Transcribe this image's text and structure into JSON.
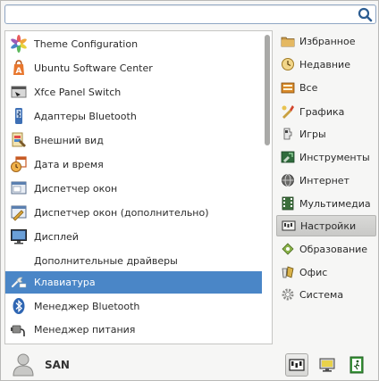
{
  "search": {
    "value": "",
    "placeholder": ""
  },
  "apps": [
    {
      "label": "Theme Configuration",
      "icon": "theme-configuration-icon"
    },
    {
      "label": "Ubuntu Software Center",
      "icon": "software-center-icon"
    },
    {
      "label": "Xfce Panel Switch",
      "icon": "panel-switch-icon"
    },
    {
      "label": "Адаптеры Bluetooth",
      "icon": "bluetooth-adapter-icon"
    },
    {
      "label": "Внешний вид",
      "icon": "appearance-icon"
    },
    {
      "label": "Дата и время",
      "icon": "date-time-icon"
    },
    {
      "label": "Диспетчер окон",
      "icon": "window-manager-icon"
    },
    {
      "label": "Диспетчер окон (дополнительно)",
      "icon": "window-manager-tweaks-icon"
    },
    {
      "label": "Дисплей",
      "icon": "display-icon"
    },
    {
      "label": "Дополнительные драйверы",
      "icon": ""
    },
    {
      "label": "Клавиатура",
      "icon": "keyboard-icon"
    },
    {
      "label": "Менеджер Bluetooth",
      "icon": "bluetooth-icon"
    },
    {
      "label": "Менеджер питания",
      "icon": "power-manager-icon"
    }
  ],
  "selected_app": "Клавиатура",
  "categories": [
    {
      "label": "Избранное",
      "icon": "favorites-icon"
    },
    {
      "label": "Недавние",
      "icon": "recent-icon"
    },
    {
      "label": "Все",
      "icon": "all-apps-icon"
    },
    {
      "label": "Графика",
      "icon": "graphics-icon"
    },
    {
      "label": "Игры",
      "icon": "games-icon"
    },
    {
      "label": "Инструменты",
      "icon": "tools-icon"
    },
    {
      "label": "Интернет",
      "icon": "internet-icon"
    },
    {
      "label": "Мультимедиа",
      "icon": "multimedia-icon"
    },
    {
      "label": "Настройки",
      "icon": "settings-icon"
    },
    {
      "label": "Образование",
      "icon": "education-icon"
    },
    {
      "label": "Офис",
      "icon": "office-icon"
    },
    {
      "label": "Система",
      "icon": "system-icon"
    }
  ],
  "active_category": "Настройки",
  "user": {
    "name": "SAN"
  },
  "bottom_buttons": [
    "settings-manager-icon",
    "lock-screen-icon",
    "logout-icon"
  ],
  "colors": {
    "selection": "#4a86c7",
    "search_border": "#8fa6c4"
  }
}
